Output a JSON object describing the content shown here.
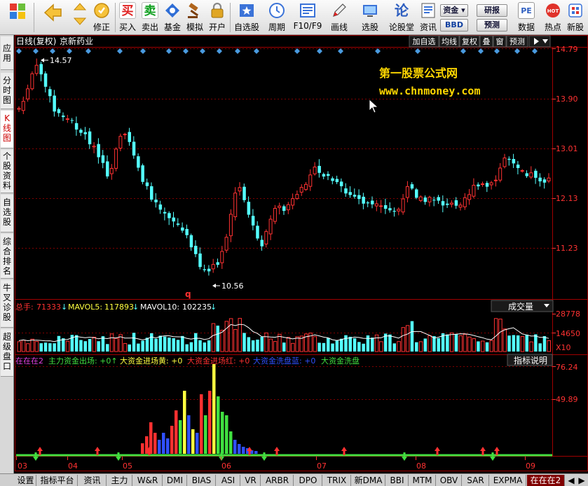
{
  "toolbar": {
    "buttons": [
      {
        "label": "",
        "icon": "windows-logo-icon"
      },
      {
        "label": "",
        "icon": "back-arrow-icon"
      },
      {
        "label": "修正",
        "icon": "up-down-arrows-icon"
      },
      {
        "label": "修正",
        "icon": "revise-icon"
      },
      {
        "label": "买入",
        "icon": "buy-icon"
      },
      {
        "label": "卖出",
        "icon": "sell-icon"
      },
      {
        "label": "基金",
        "icon": "fund-icon"
      },
      {
        "label": "模拟",
        "icon": "gavel-icon"
      },
      {
        "label": "开户",
        "icon": "lock-icon"
      },
      {
        "label": "自选股",
        "icon": "star-list-icon"
      },
      {
        "label": "周期",
        "icon": "clock-icon"
      },
      {
        "label": "F10/F9",
        "icon": "f10-icon"
      },
      {
        "label": "画线",
        "icon": "pencil-icon"
      },
      {
        "label": "选股",
        "icon": "screen-icon"
      },
      {
        "label": "论股堂",
        "icon": "forum-icon"
      },
      {
        "label": "资讯",
        "icon": "news-icon"
      },
      {
        "label": "数据",
        "icon": "pe-icon"
      },
      {
        "label": "热点",
        "icon": "hot-icon"
      },
      {
        "label": "新股",
        "icon": "new-stock-icon"
      }
    ],
    "fund_btn": "资金",
    "bbd_btn": "BBD",
    "research_btn": "研报",
    "forecast_btn": "预测"
  },
  "side_tabs": [
    {
      "label": "应用",
      "active": false
    },
    {
      "label": "分时图",
      "active": false
    },
    {
      "label": "K线图",
      "active": true
    },
    {
      "label": "个股资料",
      "active": false
    },
    {
      "label": "自选股",
      "active": false
    },
    {
      "label": "综合排名",
      "active": false
    },
    {
      "label": "牛叉诊股",
      "active": false
    },
    {
      "label": "超级盘口",
      "active": false
    }
  ],
  "chart": {
    "period_label": "日线(复权)",
    "stock_name": "京新药业",
    "right_tools": [
      "加自选",
      "均线",
      "复权",
      "叠",
      "窗",
      "预测"
    ],
    "watermark_title": "第一股票公式网",
    "watermark_url": "www.chnmoney.com",
    "high_label": "14.57",
    "low_label": "10.56",
    "q_marker": "q",
    "price_axis": [
      "14.79",
      "13.90",
      "13.01",
      "12.13",
      "11.23"
    ],
    "volume_header": {
      "total_label": "总手:",
      "total_value": "71333",
      "ma5_label": "MAVOL5:",
      "ma5_value": "117893",
      "ma10_label": "MAVOL10:",
      "ma10_value": "102235"
    },
    "volume_selector": "成交量",
    "volume_axis": [
      "28778",
      "14650",
      "X10"
    ],
    "indicator_header": [
      {
        "text": "在在在2",
        "color": "#e040e0"
      },
      {
        "text": "主力资金出场: +0↑",
        "color": "#40e040"
      },
      {
        "text": "大资金进场黄: +0",
        "color": "#ffff40"
      },
      {
        "text": "大资金进场红: +0",
        "color": "#ff3030"
      },
      {
        "text": "大资金洗盘蓝: +0",
        "color": "#3050ff"
      },
      {
        "text": "大资金洗盘",
        "color": "#40e040"
      }
    ],
    "indicator_button": "指标说明",
    "indicator_axis": [
      "76.24",
      "49.89"
    ],
    "date_axis": [
      "03",
      "04",
      "05",
      "06",
      "07",
      "08",
      "09"
    ]
  },
  "bottom_tabs": [
    {
      "label": "设置",
      "active": false
    },
    {
      "label": "指标平台",
      "active": false
    },
    {
      "label": "资讯",
      "active": false
    },
    {
      "label": "主力",
      "active": false
    },
    {
      "label": "W&R",
      "active": false
    },
    {
      "label": "DMI",
      "active": false
    },
    {
      "label": "BIAS",
      "active": false
    },
    {
      "label": "ASI",
      "active": false
    },
    {
      "label": "VR",
      "active": false
    },
    {
      "label": "ARBR",
      "active": false
    },
    {
      "label": "DPO",
      "active": false
    },
    {
      "label": "TRIX",
      "active": false
    },
    {
      "label": "新DMA",
      "active": false
    },
    {
      "label": "BBI",
      "active": false
    },
    {
      "label": "MTM",
      "active": false
    },
    {
      "label": "OBV",
      "active": false
    },
    {
      "label": "SAR",
      "active": false
    },
    {
      "label": "EXPMA",
      "active": false
    },
    {
      "label": "在在在2",
      "active": true
    }
  ],
  "colors": {
    "up": "#ff3232",
    "down": "#54ffff",
    "grid": "#800000",
    "axis_text": "#ff3232"
  }
}
